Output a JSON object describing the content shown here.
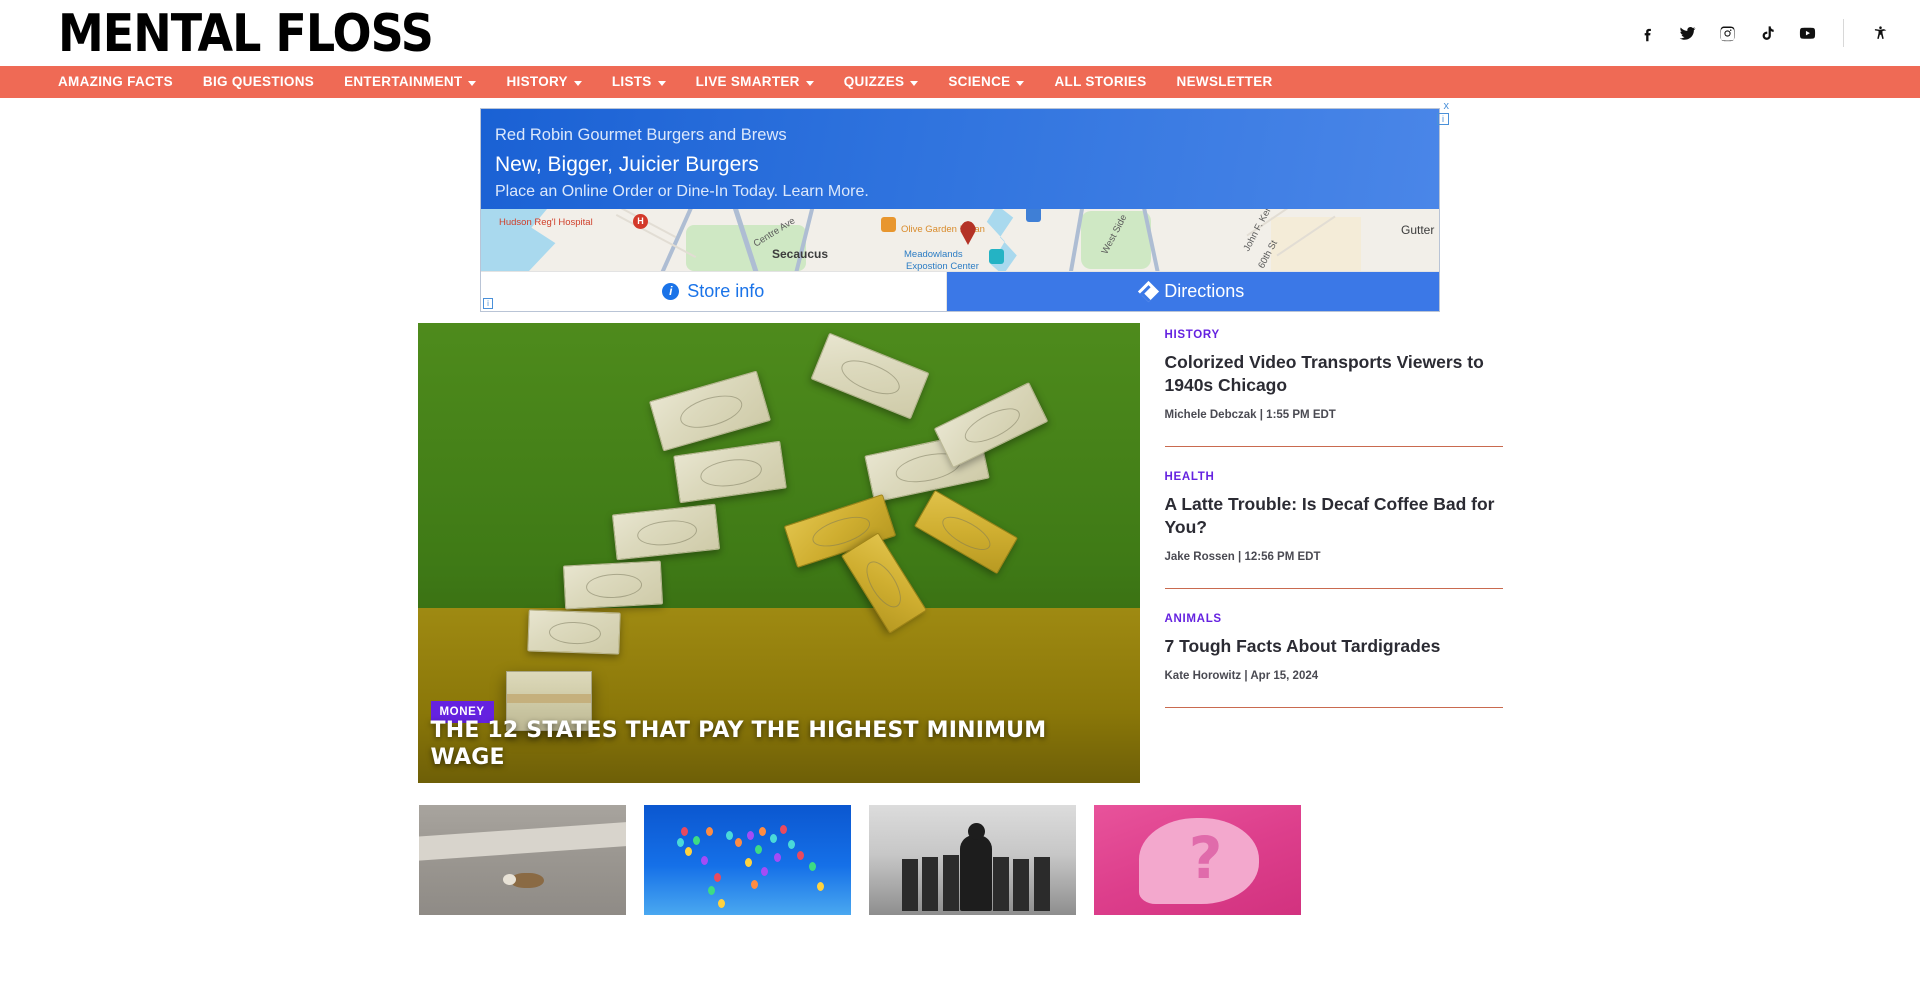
{
  "site": {
    "logo_text": "MENTAL FLOSS"
  },
  "social": {
    "items": [
      {
        "name": "facebook-icon",
        "label": "Facebook"
      },
      {
        "name": "twitter-icon",
        "label": "Twitter"
      },
      {
        "name": "instagram-icon",
        "label": "Instagram"
      },
      {
        "name": "tiktok-icon",
        "label": "TikTok"
      },
      {
        "name": "youtube-icon",
        "label": "YouTube"
      }
    ],
    "accessibility_label": "Accessibility"
  },
  "nav": {
    "background_color": "#ef6a55",
    "items": [
      {
        "label": "AMAZING FACTS",
        "has_dropdown": false
      },
      {
        "label": "BIG QUESTIONS",
        "has_dropdown": false
      },
      {
        "label": "ENTERTAINMENT",
        "has_dropdown": true
      },
      {
        "label": "HISTORY",
        "has_dropdown": true
      },
      {
        "label": "LISTS",
        "has_dropdown": true
      },
      {
        "label": "LIVE SMARTER",
        "has_dropdown": true
      },
      {
        "label": "QUIZZES",
        "has_dropdown": true
      },
      {
        "label": "SCIENCE",
        "has_dropdown": true
      },
      {
        "label": "ALL STORIES",
        "has_dropdown": false
      },
      {
        "label": "NEWSLETTER",
        "has_dropdown": false
      }
    ]
  },
  "ad": {
    "close_label": "x",
    "adchoices_label": "i",
    "advertiser": "Red Robin Gourmet Burgers and Brews",
    "headline": "New, Bigger, Juicier Burgers",
    "description": "Place an Online Order or Dine-In Today. Learn More.",
    "store_info_label": "Store info",
    "directions_label": "Directions",
    "map_labels": {
      "hospital": "Hudson Reg'l Hospital",
      "hospital_marker": "H",
      "centre_ave": "Centre Ave",
      "city": "Secaucus",
      "olive_garden": "Olive Garden Italian",
      "meadowlands": "Meadowlands",
      "expo_center": "Expostion Center",
      "west_side": "West Side",
      "john_f_ken": "John F. Ken",
      "sixtieth_st": "60th St",
      "gutter": "Gutter"
    }
  },
  "hero": {
    "badge": "MONEY",
    "badge_color": "#6522e0",
    "title": "THE 12 STATES THAT PAY THE HIGHEST MINIMUM WAGE"
  },
  "sidebar": {
    "articles": [
      {
        "kicker": "HISTORY",
        "title": "Colorized Video Transports Viewers to 1940s Chicago",
        "author": "Michele Debczak",
        "separator": "|",
        "timestamp": "1:55 PM EDT"
      },
      {
        "kicker": "HEALTH",
        "title": "A Latte Trouble: Is Decaf Coffee Bad for You?",
        "author": "Jake Rossen",
        "separator": "|",
        "timestamp": "12:56 PM EDT"
      },
      {
        "kicker": "ANIMALS",
        "title": "7 Tough Facts About Tardigrades",
        "author": "Kate Horowitz",
        "separator": "|",
        "timestamp": "Apr 15, 2024"
      }
    ],
    "kicker_color": "#6522e0",
    "separator_color": "#c96a4f"
  },
  "thumbnails": [
    {
      "name": "thumbnail-roadkill"
    },
    {
      "name": "thumbnail-world-map"
    },
    {
      "name": "thumbnail-vintage-group-photo"
    },
    {
      "name": "thumbnail-question-bubble"
    }
  ]
}
